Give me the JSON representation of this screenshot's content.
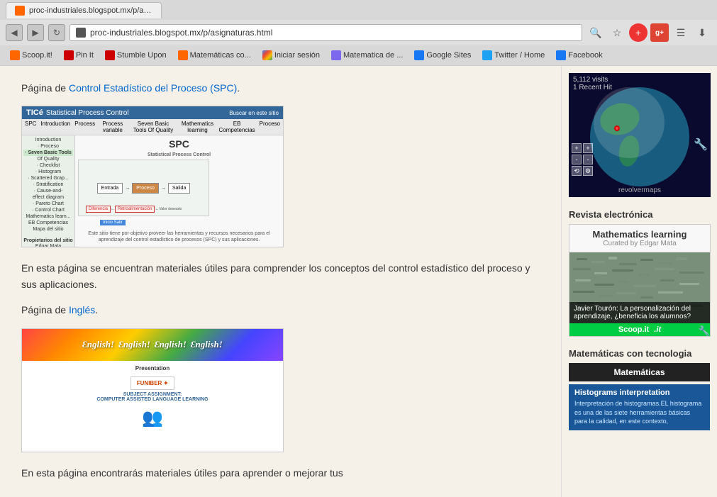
{
  "browser": {
    "tab_favicon": "orange",
    "tab_title": "proc-industriales.blogspot.mx/p/asignaturas.html",
    "address": "proc-industriales.blogspot.mx/p/asignaturas.html",
    "bookmarks": [
      {
        "label": "Scoop.it!",
        "color": "orange",
        "icon": "S"
      },
      {
        "label": "Pin It",
        "color": "red",
        "icon": "P"
      },
      {
        "label": "Stumble Upon",
        "color": "red",
        "icon": "Su"
      },
      {
        "label": "Matemáticas co...",
        "color": "orange",
        "icon": "B"
      },
      {
        "label": "Iniciar sesión",
        "color": "squares",
        "icon": "W"
      },
      {
        "label": "Matematica de ...",
        "color": "gray",
        "icon": "M"
      },
      {
        "label": "Google Sites",
        "color": "blue",
        "icon": "G"
      },
      {
        "label": "Twitter / Home",
        "color": "twitter",
        "icon": "T"
      },
      {
        "label": "Facebook",
        "color": "facebook",
        "icon": "f"
      }
    ]
  },
  "main": {
    "spc_intro": "Página de",
    "spc_link_text": "Control Estadístico del Proceso (SPC)",
    "spc_link_end": ".",
    "spc_description": "En esta página se encuentran materiales útiles para comprender los conceptos del control estadístico del proceso y sus aplicaciones.",
    "ingles_intro": "Página de",
    "ingles_link_text": "Inglés",
    "ingles_link_end": ".",
    "ingles_description": "En esta página encontrarás materiales útiles para aprender o mejorar tus",
    "spc_screenshot": {
      "site_title": "Statistical Process Control",
      "heading": "SPC",
      "diagram_label": "Statistical Process Control",
      "boxes": [
        "Entrada",
        "Proceso",
        "Salida"
      ],
      "description": "Este sitio tiene por objetivo proveer las herramientas y recursos necesarios para el aprendizaje del control estadístico de procesos (SPC) y sus aplicaciones."
    },
    "english_screenshot": {
      "words": [
        "English!",
        "English!",
        "English!",
        "English!"
      ],
      "subtitle": "Presentation",
      "funiber": "FUNIBER",
      "subject": "SUBJECT ASSIGNMENT:",
      "course": "COMPUTER ASSISTED LANGUAGE LEARNING"
    }
  },
  "sidebar": {
    "visits_line1": "5,112 visits",
    "visits_line2": "1 Recent Hit",
    "revolver_label": "revolvermaps",
    "globe_controls": [
      "+",
      "-",
      "◁",
      "▷",
      "△",
      "▽"
    ],
    "revista_title": "Revista electrónica",
    "scoop_card_title": "Mathematics learning",
    "scoop_card_subtitle": "Curated by Edgar Mata",
    "scoop_caption": "Javier Tourón: La personalización del aprendizaje, ¿beneficia los alumnos?",
    "scoop_footer": "Scoop.it",
    "matematicas_title": "Matemáticas con tecnologia",
    "matematicas_btn": "Matemáticas",
    "histograms_title": "Histograms interpretation",
    "histograms_text": "Interpretación de histogramas.EL histograma es una de las siete herramientas básicas para la calidad, en este contexto,"
  }
}
